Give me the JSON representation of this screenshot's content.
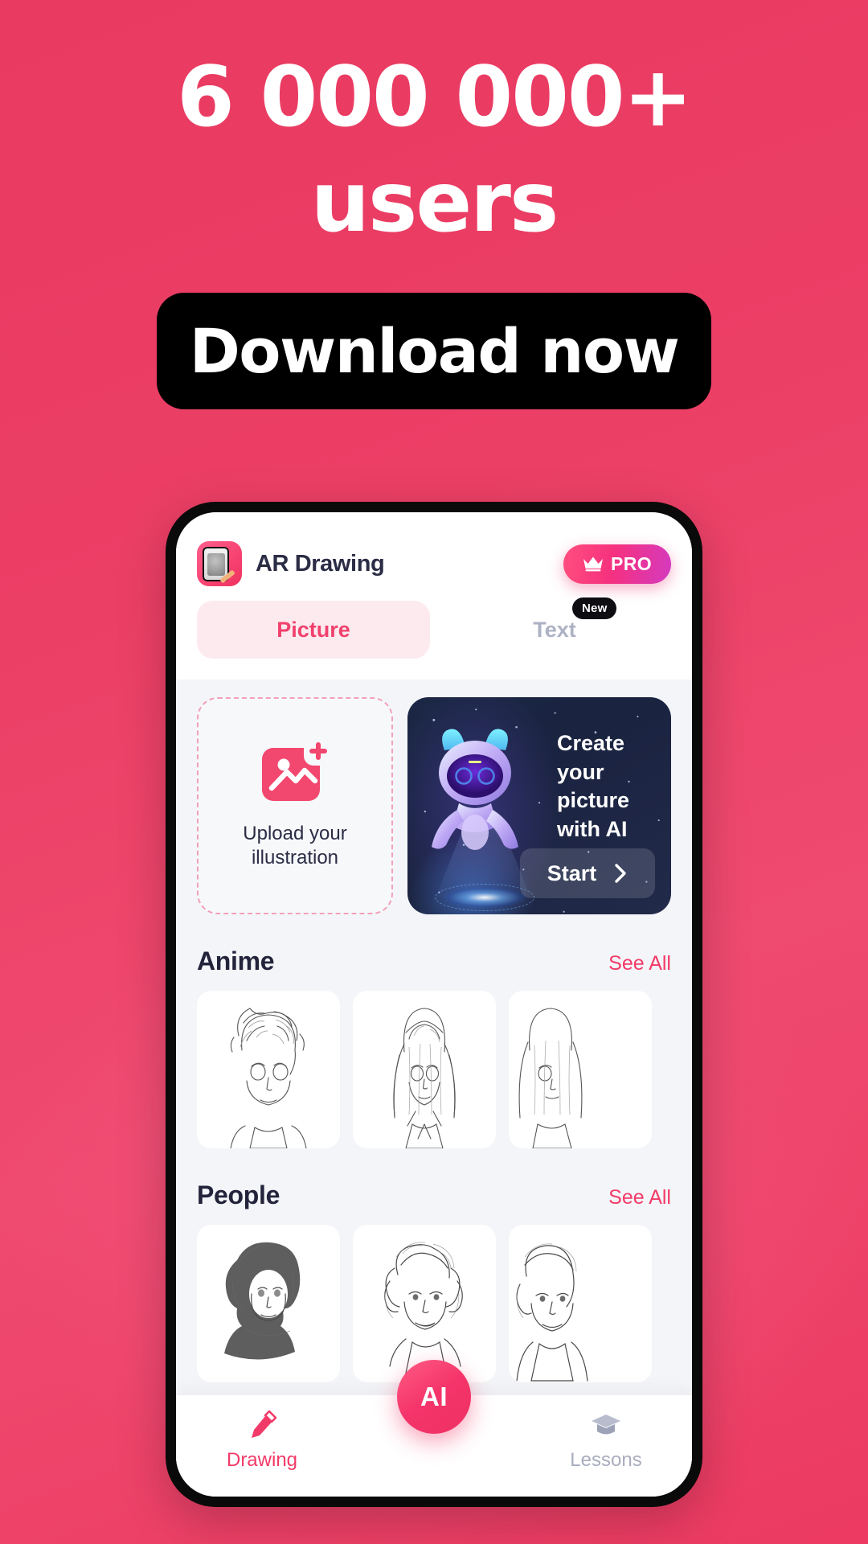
{
  "hero": {
    "title_line1": "6 000 000+",
    "title_line2": "users",
    "cta_label": "Download now"
  },
  "colors": {
    "background_pink": "#ec3f66",
    "accent_pink": "#f23a68",
    "cta_background": "#000000",
    "app_title_navy": "#2b2c45",
    "ai_card_navy": "#1b2744",
    "muted_gray": "#a9adbe"
  },
  "app": {
    "title": "AR Drawing",
    "icon_name": "app-icon-ar-drawing",
    "pro_badge": {
      "label": "PRO",
      "icon": "crown-icon"
    },
    "tabs": [
      {
        "label": "Picture",
        "active": true,
        "badge": null
      },
      {
        "label": "Text",
        "active": false,
        "badge": "New"
      }
    ],
    "upload_card": {
      "line1": "Upload your",
      "line2": "illustration",
      "icon": "image-plus-icon"
    },
    "ai_card": {
      "headline_line1": "Create",
      "headline_line2": "your picture",
      "headline_line3": "with AI",
      "button_label": "Start",
      "button_icon": "chevron-right-icon",
      "illustration": "ai-robot-icon"
    },
    "sections": [
      {
        "title": "Anime",
        "see_all": "See All",
        "thumbs": [
          "anime-boy-lineart",
          "anime-girl-lineart",
          "anime-girl-lineart-2"
        ]
      },
      {
        "title": "People",
        "see_all": "See All",
        "thumbs": [
          "portrait-woman-sketch",
          "portrait-woman-sketch-2",
          "portrait-man-sketch"
        ]
      }
    ],
    "bottom_nav": {
      "items": [
        {
          "label": "Drawing",
          "icon": "pencil-icon",
          "active": true
        },
        {
          "label": "Lessons",
          "icon": "graduation-cap-icon",
          "active": false
        }
      ],
      "fab_label": "AI"
    }
  }
}
